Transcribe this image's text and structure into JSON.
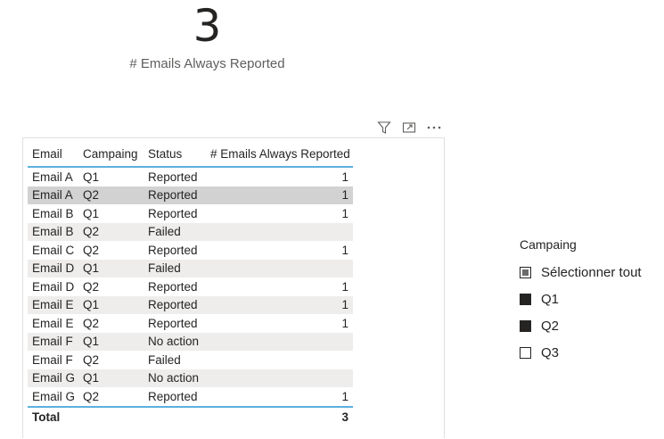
{
  "kpi": {
    "value": "3",
    "label": "# Emails Always Reported"
  },
  "visual_header": {
    "icons": [
      "filter-icon",
      "focus-mode-icon",
      "more-options-icon"
    ]
  },
  "table": {
    "columns": [
      "Email",
      "Campaing",
      "Status",
      "# Emails Always Reported"
    ],
    "rows": [
      {
        "email": "Email A",
        "campaign": "Q1",
        "status": "Reported",
        "count": "1"
      },
      {
        "email": "Email A",
        "campaign": "Q2",
        "status": "Reported",
        "count": "1"
      },
      {
        "email": "Email B",
        "campaign": "Q1",
        "status": "Reported",
        "count": "1"
      },
      {
        "email": "Email B",
        "campaign": "Q2",
        "status": "Failed",
        "count": ""
      },
      {
        "email": "Email C",
        "campaign": "Q2",
        "status": "Reported",
        "count": "1"
      },
      {
        "email": "Email D",
        "campaign": "Q1",
        "status": "Failed",
        "count": ""
      },
      {
        "email": "Email D",
        "campaign": "Q2",
        "status": "Reported",
        "count": "1"
      },
      {
        "email": "Email E",
        "campaign": "Q1",
        "status": "Reported",
        "count": "1"
      },
      {
        "email": "Email E",
        "campaign": "Q2",
        "status": "Reported",
        "count": "1"
      },
      {
        "email": "Email F",
        "campaign": "Q1",
        "status": "No action",
        "count": ""
      },
      {
        "email": "Email F",
        "campaign": "Q2",
        "status": "Failed",
        "count": ""
      },
      {
        "email": "Email G",
        "campaign": "Q1",
        "status": "No action",
        "count": ""
      },
      {
        "email": "Email G",
        "campaign": "Q2",
        "status": "Reported",
        "count": "1"
      }
    ],
    "total": {
      "label": "Total",
      "count": "3"
    }
  },
  "slicer": {
    "title": "Campaing",
    "items": [
      {
        "label": "Sélectionner tout",
        "state": "partial"
      },
      {
        "label": "Q1",
        "state": "checked"
      },
      {
        "label": "Q2",
        "state": "checked"
      },
      {
        "label": "Q3",
        "state": "unchecked"
      }
    ]
  },
  "colors": {
    "accent_line": "#5bb0de",
    "row_alt": "#eeedec",
    "row_selected": "#d2d2d2",
    "text": "#252423"
  }
}
